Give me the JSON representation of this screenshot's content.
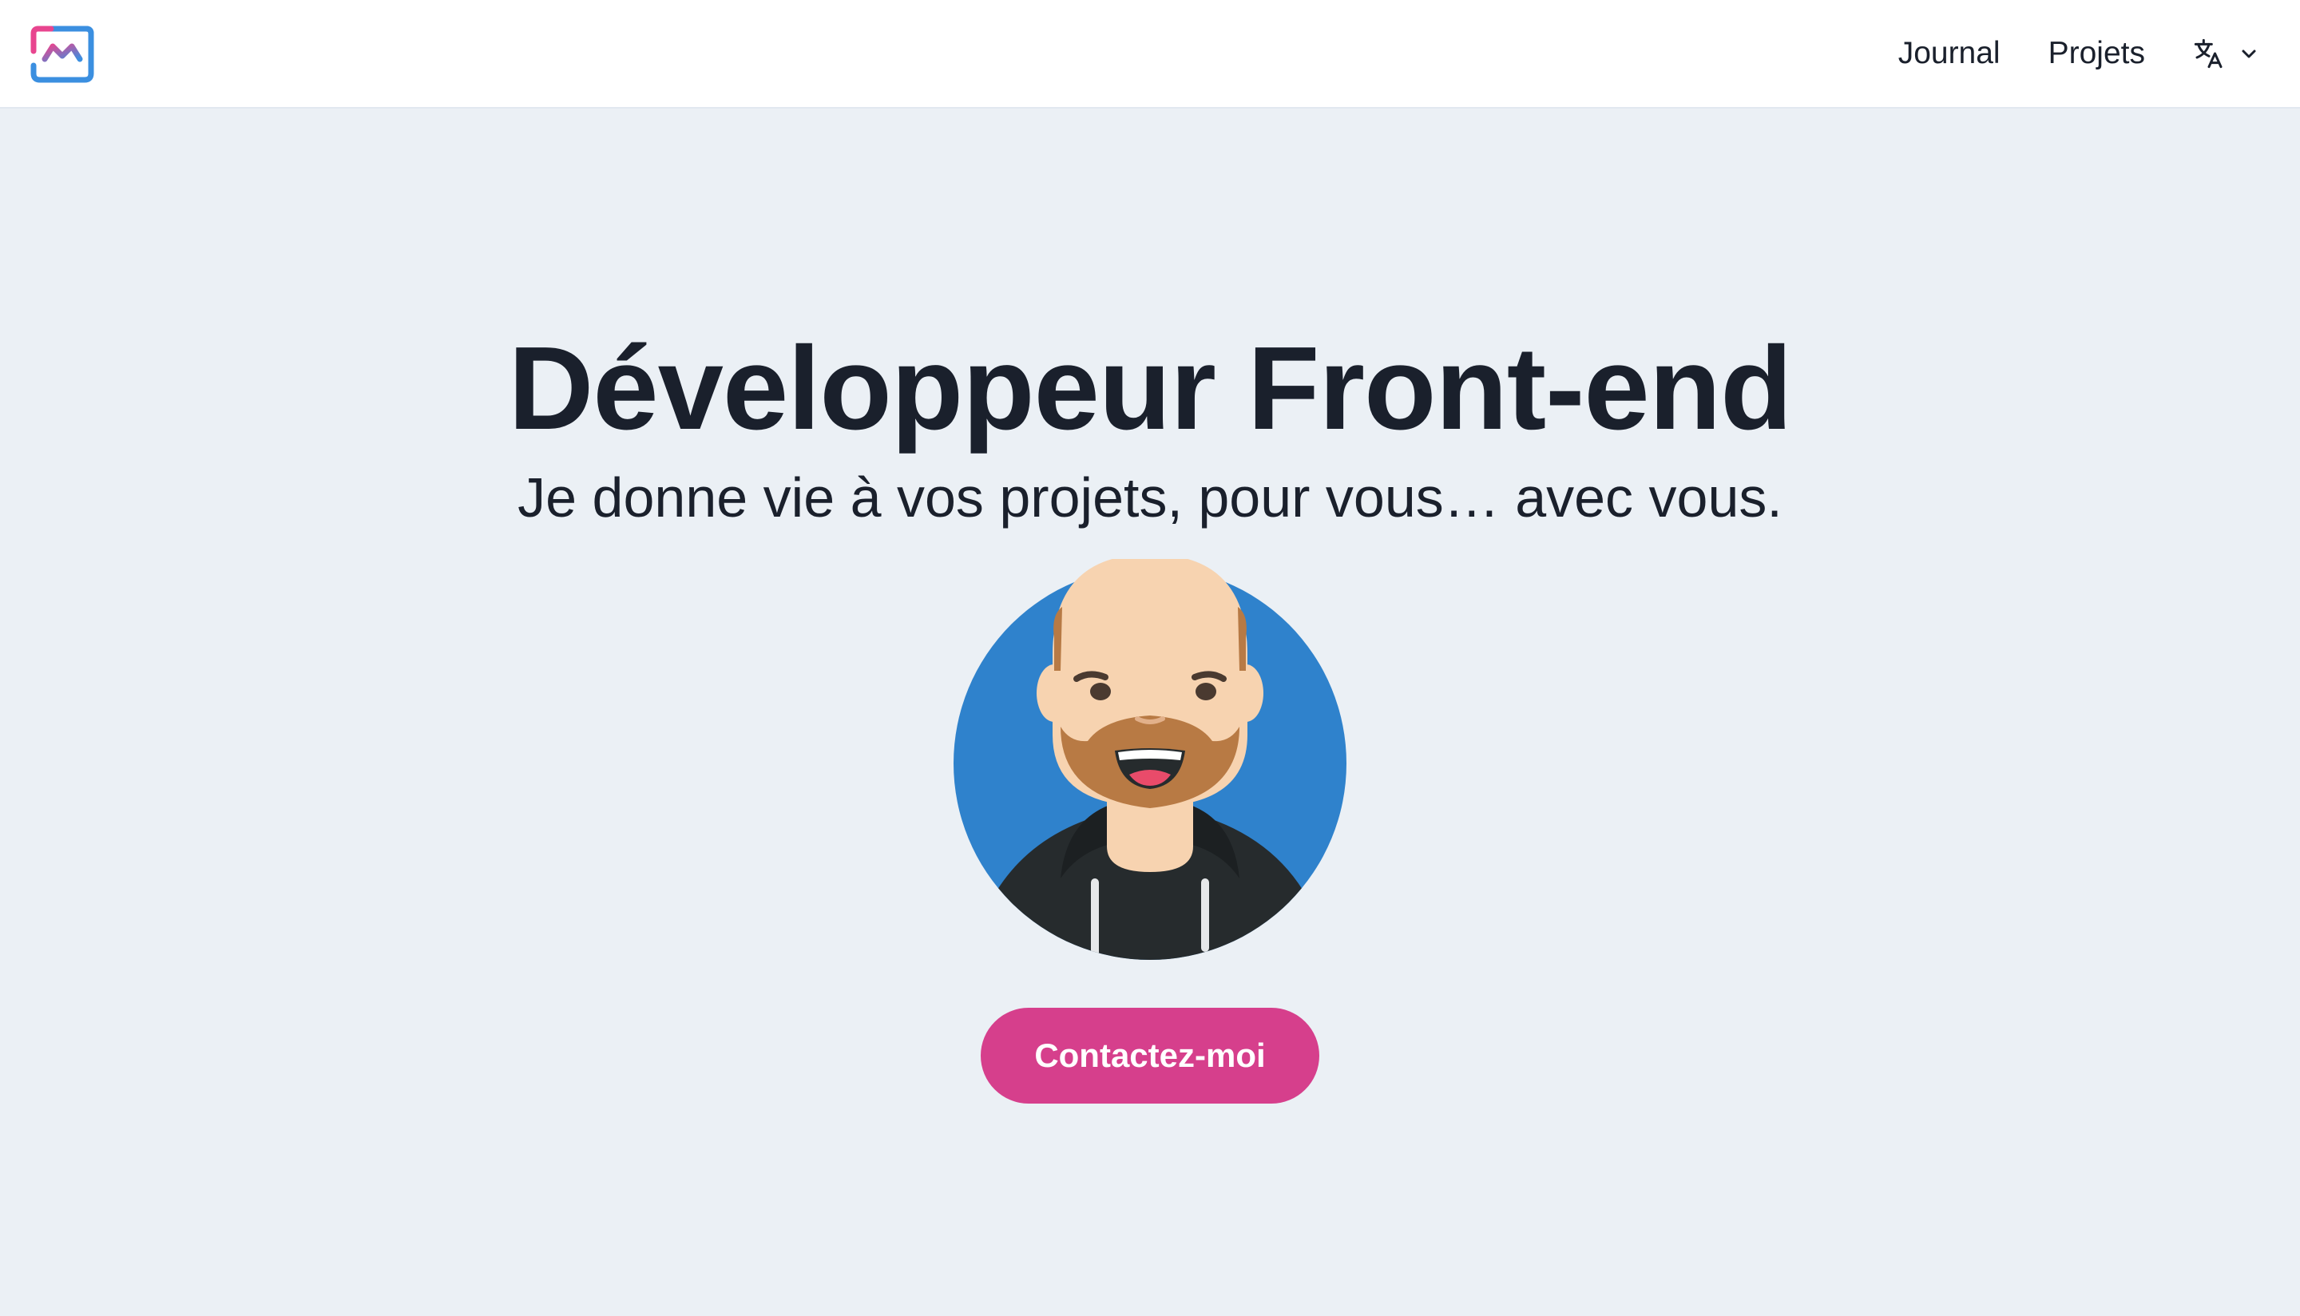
{
  "brand": {
    "logo": "brand-logo-icon",
    "accent": "#d63f8c"
  },
  "nav": {
    "items": [
      {
        "label": "Journal"
      },
      {
        "label": "Projets"
      }
    ],
    "language_icon": "translate-icon",
    "dropdown_icon": "chevron-down-icon"
  },
  "hero": {
    "title": "Développeur Front-end",
    "subtitle": "Je donne vie à vos projets, pour vous… avec vous.",
    "avatar": "avatar-illustration",
    "cta_label": "Contactez-moi"
  },
  "colors": {
    "background": "#ebf0f5",
    "text": "#1a202c",
    "avatar_bg": "#2f82cc",
    "cta": "#d63f8c"
  }
}
